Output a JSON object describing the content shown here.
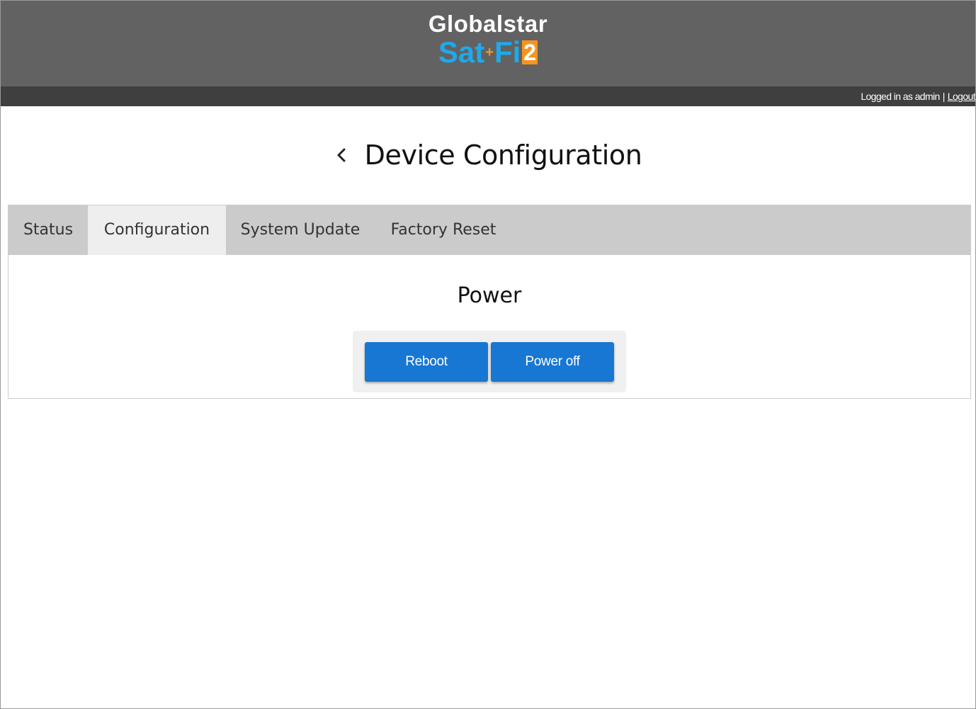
{
  "header": {
    "logo": {
      "line1": "Globalstar",
      "sat": "Sat",
      "plus": "+",
      "fi": "Fi",
      "number": "2"
    },
    "user_bar": {
      "logged_in_text": "Logged in as admin",
      "separator": "|",
      "logout_label": "Logout"
    }
  },
  "page": {
    "title": "Device Configuration",
    "back_icon": "chevron-left-icon"
  },
  "tabs": [
    {
      "label": "Status",
      "active": false
    },
    {
      "label": "Configuration",
      "active": true
    },
    {
      "label": "System Update",
      "active": false
    },
    {
      "label": "Factory Reset",
      "active": false
    }
  ],
  "power_section": {
    "title": "Power",
    "buttons": {
      "reboot": "Reboot",
      "power_off": "Power off"
    }
  },
  "colors": {
    "header_bg": "#626262",
    "userbar_bg": "#3f3f3f",
    "tabbar_bg": "#cbcbcb",
    "active_tab_bg": "#eeeeee",
    "button_bg": "#1877d2",
    "logo_blue": "#1fa9ea",
    "logo_orange": "#f7941d"
  }
}
